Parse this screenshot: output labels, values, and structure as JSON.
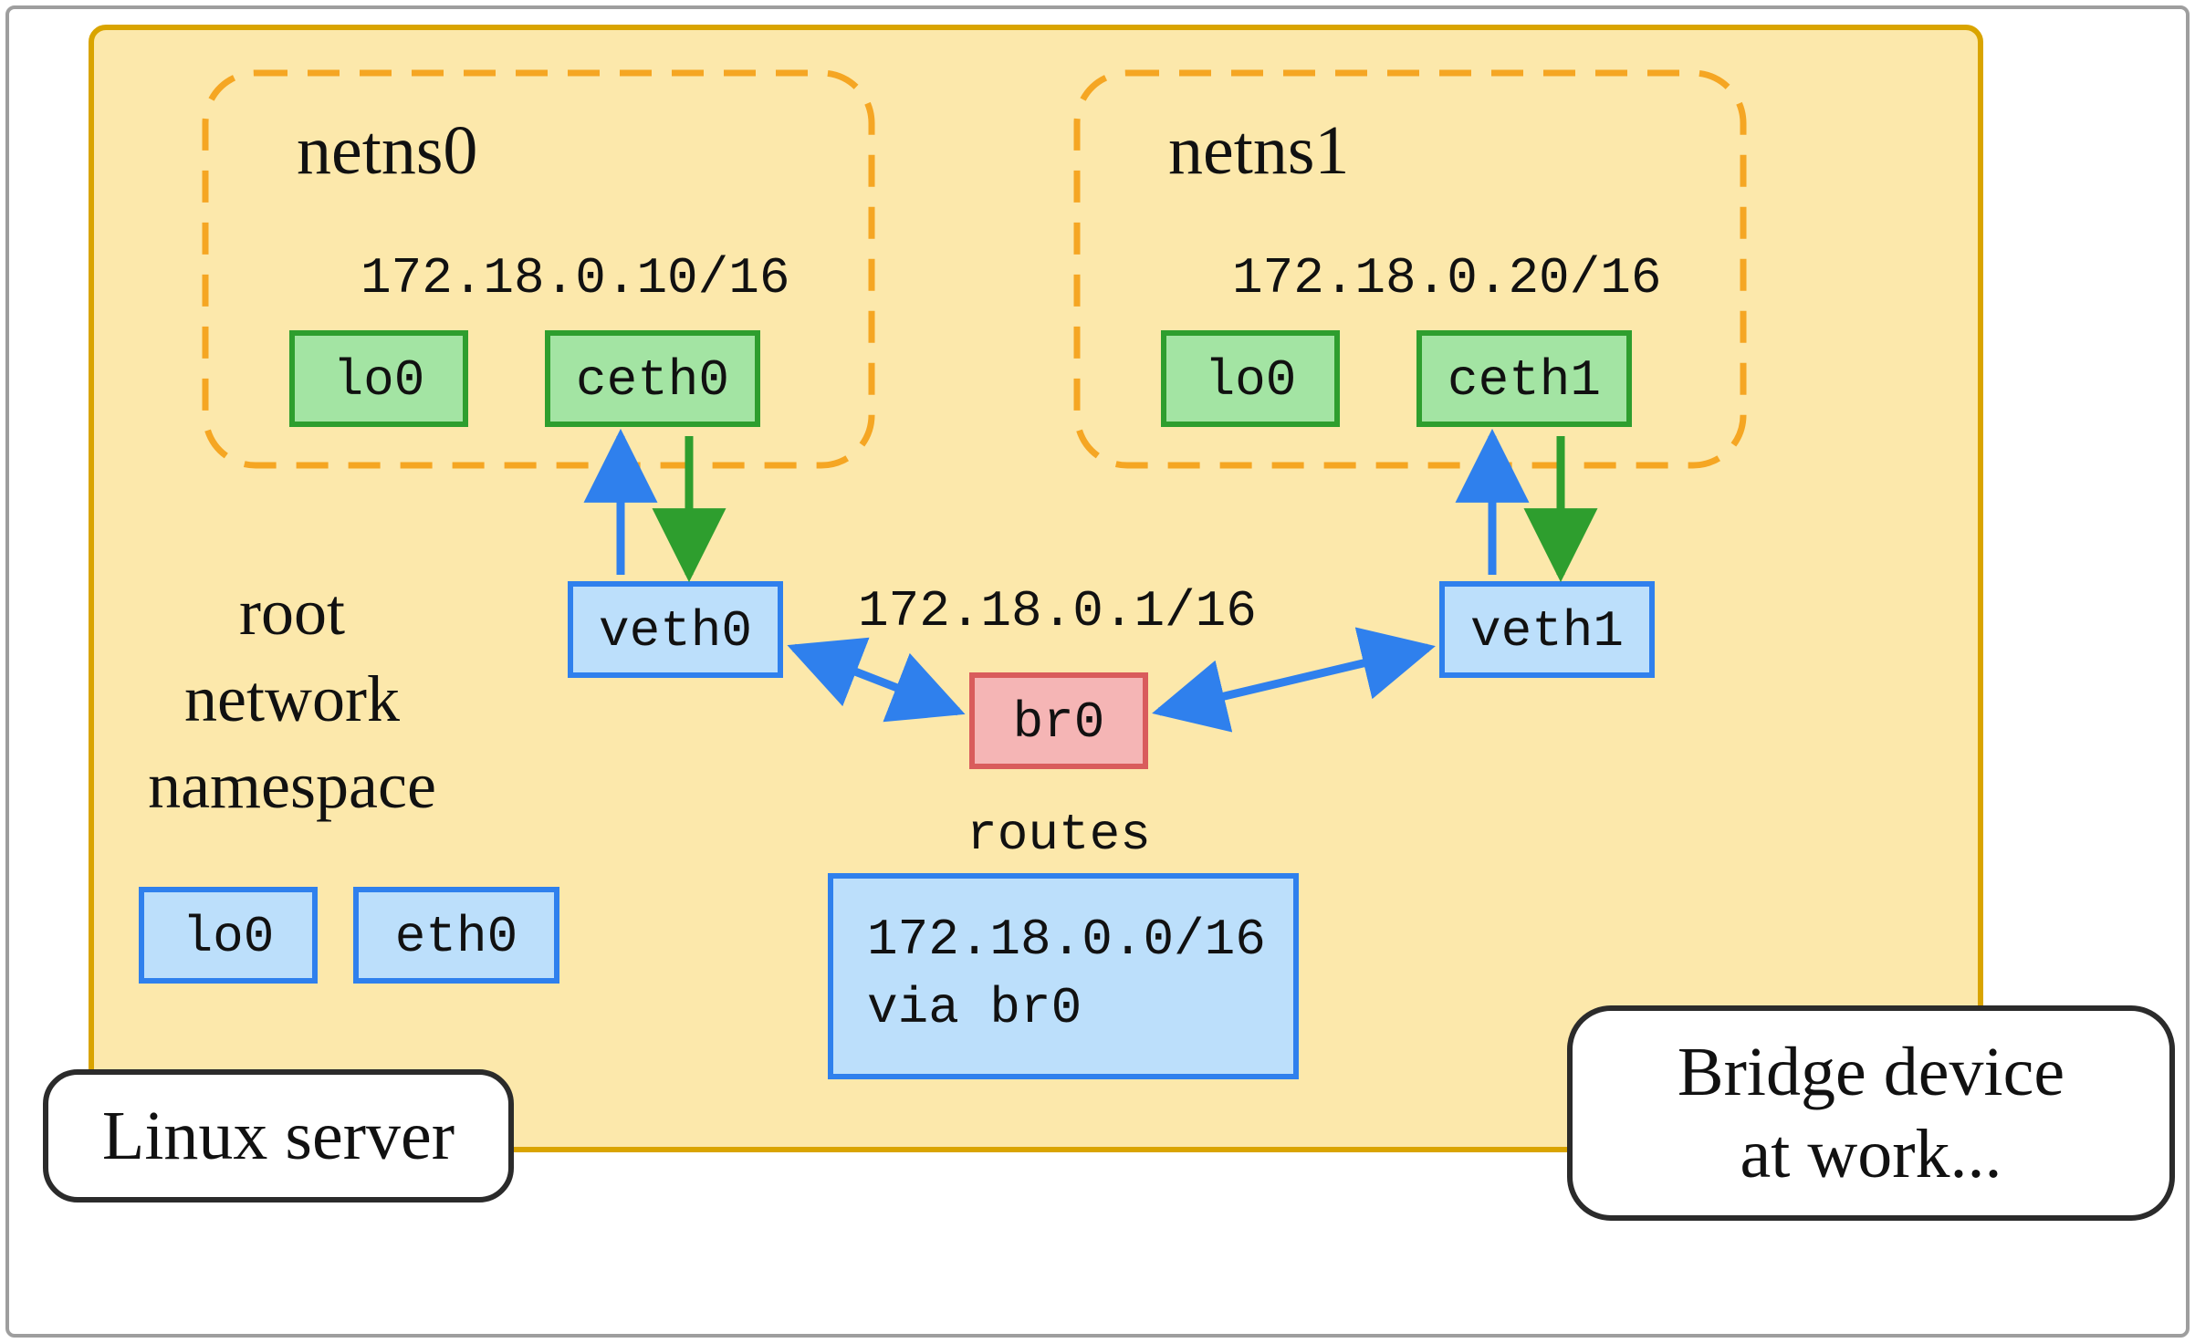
{
  "server_label": "Linux server",
  "caption": {
    "line1": "Bridge device",
    "line2": "at work..."
  },
  "root_ns": {
    "label_l1": "root",
    "label_l2": "network",
    "label_l3": "namespace",
    "lo": "lo0",
    "eth": "eth0"
  },
  "netns0": {
    "title": "netns0",
    "ip": "172.18.0.10/16",
    "lo": "lo0",
    "ceth": "ceth0",
    "veth": "veth0"
  },
  "netns1": {
    "title": "netns1",
    "ip": "172.18.0.20/16",
    "lo": "lo0",
    "ceth": "ceth1",
    "veth": "veth1"
  },
  "bridge": {
    "name": "br0",
    "ip": "172.18.0.1/16"
  },
  "routes": {
    "title": "routes",
    "line1": "172.18.0.0/16",
    "line2": "via br0"
  },
  "colors": {
    "outline": "#9e9e9e",
    "server_fill": "#fce8ab",
    "server_stroke": "#d9a400",
    "ns_dash": "#f5a623",
    "green_fill": "#a3e4a3",
    "green_stroke": "#2e9e2e",
    "blue_fill": "#bcdffb",
    "blue_stroke": "#2f80ed",
    "red_fill": "#f5b5b5",
    "red_stroke": "#d95c5c",
    "arrow_blue": "#2f80ed",
    "arrow_green": "#2e9e2e",
    "text": "#111111",
    "shadow": "#2b2b2b"
  }
}
